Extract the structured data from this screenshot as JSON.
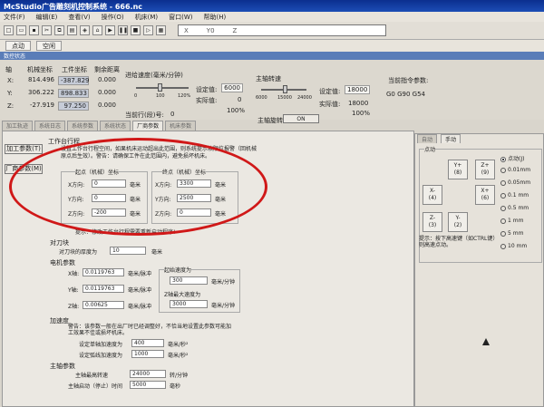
{
  "window": {
    "title": "McStudio广告雕刻机控制系统 - 666.nc"
  },
  "menu": [
    "文件(F)",
    "编辑(E)",
    "查看(V)",
    "操作(O)",
    "机床(M)",
    "窗口(W)",
    "帮助(H)"
  ],
  "toolbar": {
    "coords": [
      "X",
      "Y0",
      "Z"
    ]
  },
  "modes": [
    "点动",
    "空闲"
  ],
  "status": {
    "header": "数控状态",
    "axis_header": "轴",
    "machine_header": "机械坐标",
    "work_header": "工件坐标",
    "remain_header": "剩余距离",
    "rows": [
      {
        "axis": "X:",
        "machine": "814.496",
        "work": "-387.829",
        "remain": "0.000"
      },
      {
        "axis": "Y:",
        "machine": "306.222",
        "work": "898.833",
        "remain": "0.000"
      },
      {
        "axis": "Z:",
        "machine": "-27.919",
        "work": "97.250",
        "remain": "0.000"
      }
    ],
    "feed_title": "进给速度(毫米/分钟)",
    "feed_ticks": [
      "0",
      "100",
      "120%"
    ],
    "feed_set_label": "设定值:",
    "feed_set": "6000",
    "feed_actual_label": "实际值:",
    "feed_actual": "0",
    "feed_pct": "100%",
    "line_label": "当前行(段)号:",
    "line_value": "0",
    "spindle_title": "主轴转速",
    "spindle_ticks": [
      "6000",
      "15000",
      "24000"
    ],
    "spindle_set_label": "设定值:",
    "spindle_set": "18000",
    "spindle_actual_label": "实际值:",
    "spindle_actual": "18000",
    "spindle_pct": "100%",
    "spindle_btn_label": "主轴旋转:",
    "spindle_btn": "ON",
    "instr_title": "当前指令参数:",
    "instr_value": "G0 G90 G54"
  },
  "tabs": [
    "加工轨迹",
    "系统日志",
    "系统参数",
    "系统状态",
    "厂商参数",
    "机床参数"
  ],
  "panel": {
    "btn_work": "加工参数(T)",
    "btn_vendor": "厂商参数(M)",
    "range_title": "工作台行程",
    "range_note": "设置工作台行程空间，如果机床运动超出此范围，则系统提示软限位报警（回机械原点后生效）。警告：请确保工件在此范围内，避免损坏机床。",
    "start_title": "起点（机械）坐标",
    "end_title": "终点（机械）坐标",
    "x_label": "X方向:",
    "y_label": "Y方向:",
    "z_label": "Z方向:",
    "start": {
      "x": "0",
      "y": "0",
      "z": "-200"
    },
    "end": {
      "x": "3300",
      "y": "2500",
      "z": "0"
    },
    "unit_mm": "毫米",
    "restart_note": "提示：修改工作台行程需要重新启动程序!",
    "tool_title": "对刀块",
    "tool_thickness_label": "对刀块的厚度为",
    "tool_thickness": "10",
    "motor_title": "电机参数",
    "x_axis": "X轴:",
    "y_axis": "Y轴:",
    "z_axis": "Z轴:",
    "pulse_x": "0.0119763",
    "pulse_y": "0.0119763",
    "pulse_z": "0.00625",
    "pulse_unit": "毫米/脉冲",
    "start_speed_title": "起始速度为",
    "start_speed": "300",
    "speed_unit": "毫米/分钟",
    "zmax_title": "Z轴最大速度为",
    "zmax_speed": "3000",
    "accel_title": "加速度",
    "accel_note": "警告：该参数一般在出厂时已经调整好，不恰当地设置此参数可能加工效果不佳或损坏机床。",
    "accel_single_label": "设定单轴加速度为",
    "accel_single": "400",
    "accel_curve_label": "设定弧线加速度为",
    "accel_curve": "1000",
    "accel_unit": "毫米/秒²",
    "spindle_title": "主轴参数",
    "spindle_max_label": "主轴最高转速",
    "spindle_max": "24000",
    "rpm_unit": "转/分钟",
    "spindle_delay_label": "主轴启动（停止）时间",
    "spindle_delay": "5000",
    "ms_unit": "毫秒"
  },
  "right": {
    "tabs": [
      "自动",
      "手动"
    ],
    "group_title": "点动",
    "jog_buttons": [
      "Y+",
      "Z+",
      "X-",
      "X+",
      "Z-",
      "Y-"
    ],
    "jog_keys": [
      "(8)",
      "(9)",
      "(4)",
      "(6)",
      "(3)",
      "(2)"
    ],
    "radio_options": [
      "点动(J)",
      "0.01mm",
      "0.05mm",
      "0.1 mm",
      "0.5 mm",
      "1 mm",
      "5 mm",
      "10 mm"
    ],
    "selected": "点动(J)",
    "hint": "提示：按下高速键（如CTRL键）则高速点动。"
  },
  "colors": {
    "annotation": "#d01818",
    "title_bar": "#0b2f8f"
  }
}
